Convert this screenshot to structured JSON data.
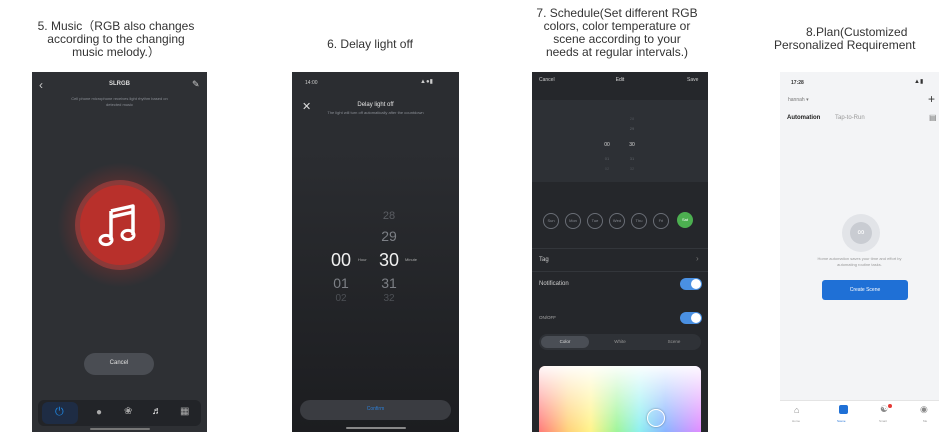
{
  "captions": {
    "music": [
      "5. Music（RGB also changes",
      "according to the changing",
      "music melody.）"
    ],
    "delay": [
      "6. Delay light off"
    ],
    "schedule": [
      "7. Schedule(Set different RGB",
      "colors, color temperature or",
      "scene according to your",
      "needs at regular intervals.)"
    ],
    "plan": [
      "8.Plan(Customized",
      "Personalized Requirement"
    ]
  },
  "music_screen": {
    "title": "SLRGB",
    "hint": [
      "Cell phone microphone receives light rhythm based on",
      "detected music"
    ],
    "cancel_label": "Cancel",
    "tabs": [
      "power",
      "color",
      "palette",
      "music",
      "scene"
    ],
    "active_tab": "music",
    "colors": {
      "background": "#2e3034",
      "accent": "#c62e2a",
      "tab_active": "#1e88e5"
    }
  },
  "delay_screen": {
    "time": "14:00",
    "title": "Delay light off",
    "subtitle": "The light will turn off automatically after the countdown",
    "hours": [
      "00",
      "01",
      "02"
    ],
    "minutes_above": [
      "28",
      "29"
    ],
    "minutes": [
      "30",
      "31",
      "32"
    ],
    "hour_unit": "Hour",
    "minute_unit": "Minute",
    "confirm_label": "Confirm"
  },
  "schedule_screen": {
    "cancel_label": "Cancel",
    "title": "Edit",
    "save_label": "Save",
    "picker_hours_above": [
      "",
      ""
    ],
    "picker_minutes_above": [
      "28",
      "29"
    ],
    "picker_hour": "00",
    "picker_minute": "30",
    "picker_hours_below": [
      "01",
      "02"
    ],
    "picker_minutes_below": [
      "31",
      "32"
    ],
    "days": [
      "Sun",
      "Mon",
      "Tue",
      "Wed",
      "Thu",
      "Fri",
      "Sat"
    ],
    "active_day": "Sat",
    "tag_label": "Tag",
    "notification_label": "Notification",
    "onoff_label": "ON/OFF",
    "modes": [
      "Color",
      "White",
      "Scene"
    ],
    "active_mode": "Color",
    "colors": {
      "toggle": "#4a90e2",
      "day_active": "#4caf50"
    }
  },
  "plan_screen": {
    "time": "17:28",
    "home_label": "hannah",
    "tab_active": "Automation",
    "tab_other": "Tap-to-Run",
    "empty_text": [
      "Home automation saves your time and effort by",
      "automating routine tasks."
    ],
    "create_label": "Create Scene",
    "nav": [
      "Home",
      "Scene",
      "Smart",
      "Me"
    ],
    "colors": {
      "primary": "#1f70d6"
    }
  }
}
